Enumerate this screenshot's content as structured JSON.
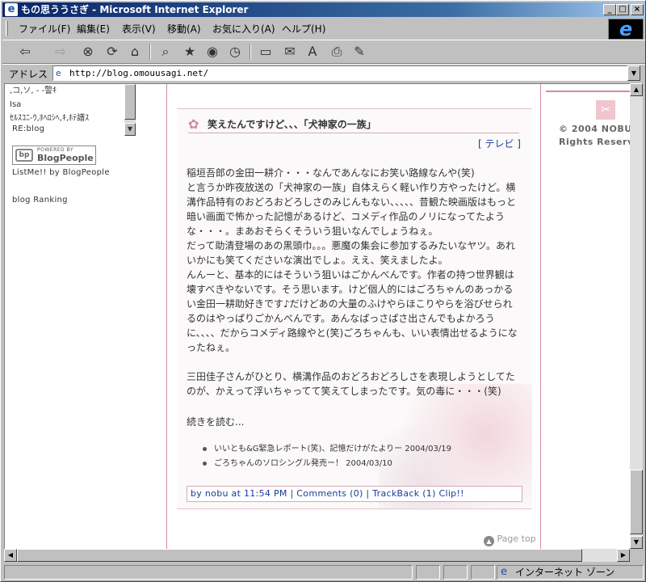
{
  "window": {
    "title": "もの思ううさぎ - Microsoft Internet Explorer",
    "minimize_label": "_",
    "maximize_label": "□",
    "close_label": "×"
  },
  "menu": {
    "items": [
      "ファイル(F)",
      "編集(E)",
      "表示(V)",
      "移動(A)",
      "お気に入り(A)",
      "ヘルプ(H)"
    ]
  },
  "address": {
    "label": "アドレス",
    "url": "http://blog.omouusagi.net/"
  },
  "sidebar": {
    "mini_list": [
      ",コ,ソ, - -警ｷ",
      "Isa",
      "ｾﾙｽｺﾆ-ｳ,ﾎﾍﾛｼﾍ,ｷ,ﾎﾃ譜ｽ"
    ],
    "powered_by": "POWERED BY",
    "blogpeople": "BlogPeople",
    "reblog": "RE:blog",
    "listme": "ListMe!! by BlogPeople",
    "ranking": "blog Ranking"
  },
  "post": {
    "title": "笑えたんですけど、、、「犬神家の一族」",
    "category": "[ テレビ ]",
    "paragraphs": [
      "稲垣吾郎の金田一耕介・・・なんであんなにお笑い路線なんや(笑)\nと言うか昨夜放送の「犬神家の一族」自体えらく軽い作り方やったけど。横溝作品特有のおどろおどろしさのみじんもない、、、、、昔観た映画版はもっと暗い画面で怖かった記憶があるけど、コメディ作品のノリになってたような・・・。まあおそらくそういう狙いなんでしょうねぇ。\nだって助清登場のあの黒頭巾。。。悪魔の集会に参加するみたいなヤツ。あれいかにも笑てくださいな演出でしょ。ええ、笑えましたよ。\nんんーと、基本的にはそういう狙いはごかんべんです。作者の持つ世界観は壊すべきやないです。そう思います。けど個人的にはごろちゃんのあっかるい金田一耕助好きです♪だけどあの大量のふけやらほこりやらを浴びせられるのはやっぱりごかんべんです。あんなぱっさぱさ出さんでもよかろうに、、、、だからコメディ路線やと(笑)ごろちゃんも、いい表情出せるようになったねぇ。",
      "三田佳子さんがひとり、横溝作品のおどろおどろしさを表現しようとしてたのが、かえって浮いちゃってて笑えてしまったです。気の毒に・・・(笑)"
    ],
    "more": "続きを読む...",
    "related": [
      "いいとも&G緊急レポート(笑)、記憶だけがたよりー 2004/03/19",
      "ごろちゃんのソロシングル発売ー！ 2004/03/10"
    ],
    "footer": "by nobu at 11:54 PM | Comments (0) | TrackBack (1) Clip!!"
  },
  "page_top": "Page top",
  "copyright": {
    "line1": "© 2004 NOBU",
    "line2": "Rights Reserv"
  },
  "status": {
    "zone": "インターネット ゾーン"
  }
}
